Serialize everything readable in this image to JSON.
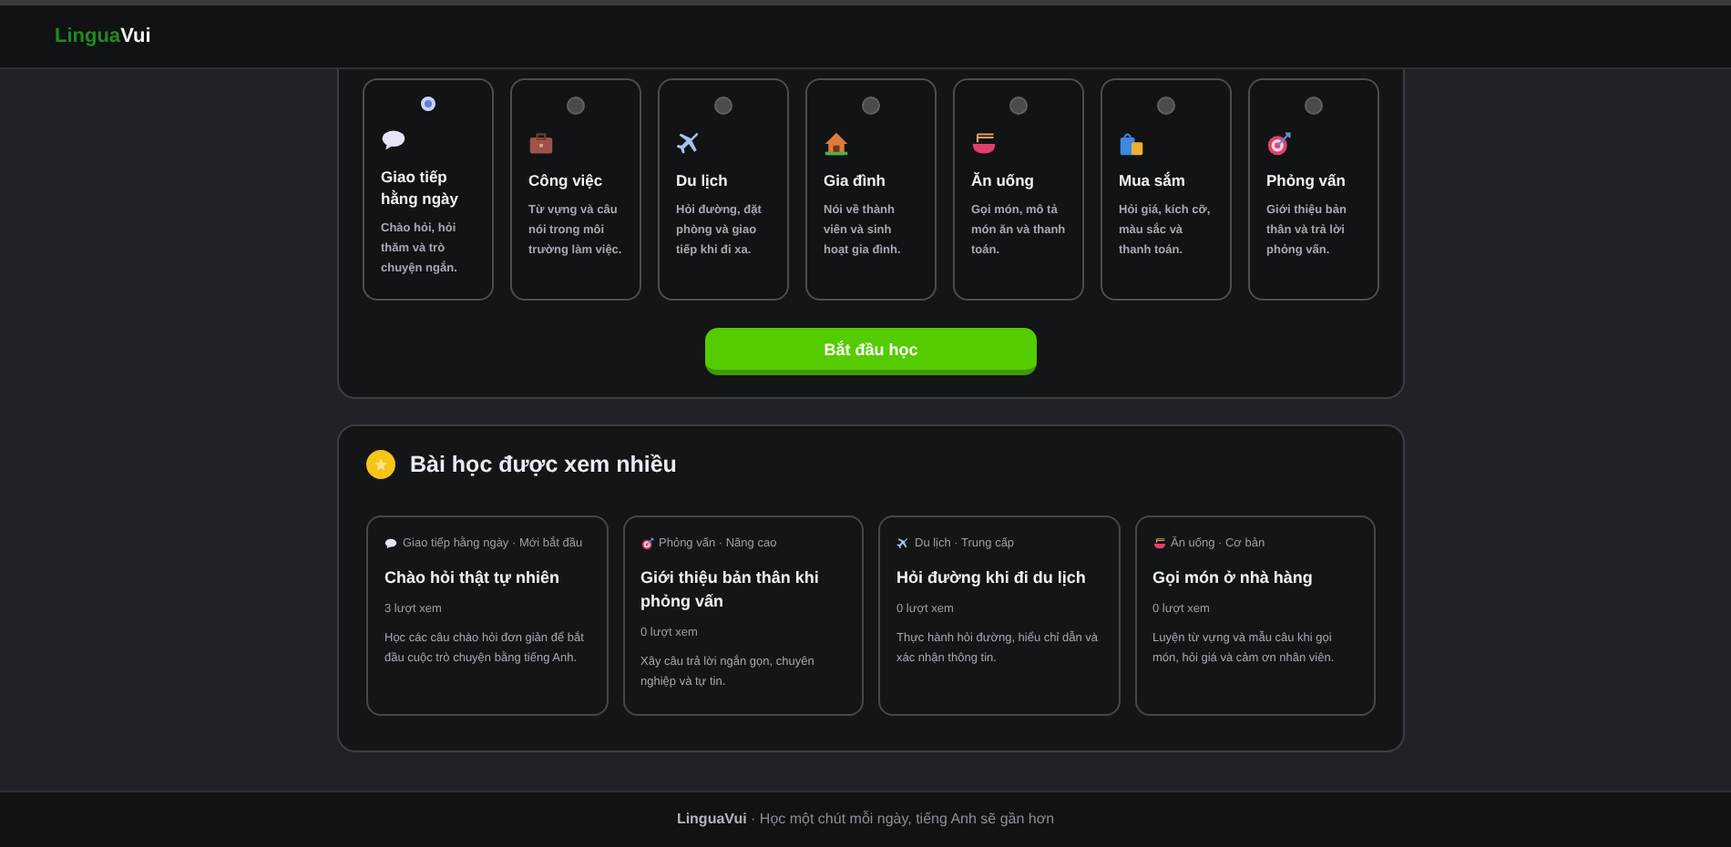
{
  "header": {
    "logo": {
      "accent": "Lingua",
      "rest": "Vui"
    }
  },
  "topics": [
    {
      "title": "Giao tiếp hằng ngày",
      "description": "Chào hỏi, hỏi thăm và trò chuyện ngắn.",
      "selected": true
    },
    {
      "title": "Công việc",
      "description": "Từ vựng và câu nói trong môi trường làm việc.",
      "selected": false
    },
    {
      "title": "Du lịch",
      "description": "Hỏi đường, đặt phòng và giao tiếp khi đi xa.",
      "selected": false
    },
    {
      "title": "Gia đình",
      "description": "Nói về thành viên và sinh hoạt gia đình.",
      "selected": false
    },
    {
      "title": "Ăn uống",
      "description": "Gọi món, mô tả món ăn và thanh toán.",
      "selected": false
    },
    {
      "title": "Mua sắm",
      "description": "Hỏi giá, kích cỡ, màu sắc và thanh toán.",
      "selected": false
    },
    {
      "title": "Phỏng vấn",
      "description": "Giới thiệu bản thân và trả lời phỏng vấn.",
      "selected": false
    }
  ],
  "start_button": "Bắt đầu học",
  "popular": {
    "heading": "Bài học được xem nhiều",
    "lessons": [
      {
        "meta": "Giao tiếp hằng ngày · Mới bắt đầu",
        "title": "Chào hỏi thật tự nhiên",
        "views": "3 lượt xem",
        "description": "Học các câu chào hỏi đơn giản để bắt đầu cuộc trò chuyện bằng tiếng Anh."
      },
      {
        "meta": "Phỏng vấn · Nâng cao",
        "title": "Giới thiệu bản thân khi phỏng vấn",
        "views": "0 lượt xem",
        "description": "Xây câu trả lời ngắn gọn, chuyên nghiệp và tự tin."
      },
      {
        "meta": "Du lịch · Trung cấp",
        "title": "Hỏi đường khi đi du lịch",
        "views": "0 lượt xem",
        "description": "Thực hành hỏi đường, hiểu chỉ dẫn và xác nhận thông tin."
      },
      {
        "meta": "Ăn uống · Cơ bản",
        "title": "Gọi món ở nhà hàng",
        "views": "0 lượt xem",
        "description": "Luyện từ vựng và mẫu câu khi gọi món, hỏi giá và cảm ơn nhân viên."
      }
    ]
  },
  "footer": {
    "brand": "LinguaVui",
    "tagline": " · Học một chút mỗi ngày, tiếng Anh sẽ gần hơn"
  }
}
